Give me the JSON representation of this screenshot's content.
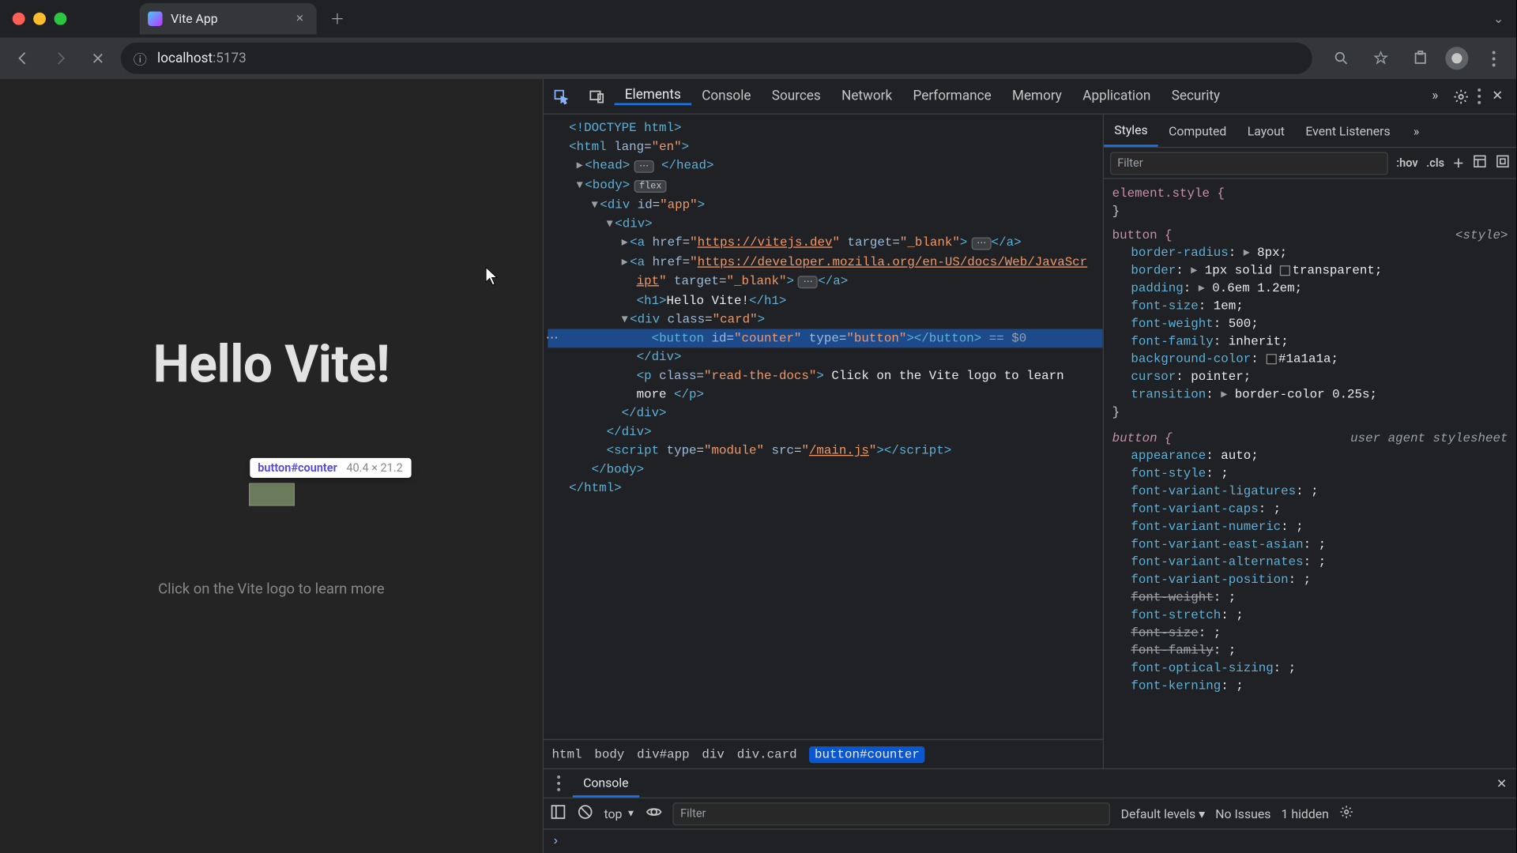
{
  "chrome": {
    "tab_title": "Vite App",
    "url_host": "localhost",
    "url_port": ":5173"
  },
  "page": {
    "heading": "Hello Vite!",
    "docs": "Click on the Vite logo to learn more",
    "inspect_tooltip_selector": "button#counter",
    "inspect_tooltip_dims": "40.4 × 21.2"
  },
  "devtools": {
    "tabs": [
      "Elements",
      "Console",
      "Sources",
      "Network",
      "Performance",
      "Memory",
      "Application",
      "Security"
    ],
    "styles_tabs": [
      "Styles",
      "Computed",
      "Layout",
      "Event Listeners"
    ],
    "breadcrumbs": [
      "html",
      "body",
      "div#app",
      "div",
      "div.card",
      "button#counter"
    ],
    "styles_filter_placeholder": "Filter",
    "styles_hov": ":hov",
    "styles_cls": ".cls",
    "element_style": "element.style {",
    "style_source": "<style>",
    "ua_source": "user agent stylesheet",
    "console_scope": "top",
    "console_levels": "Default levels ▾",
    "console_issues": "No Issues",
    "console_hidden": "1 hidden",
    "console_filter_placeholder": "Filter",
    "drawer_tab": "Console"
  },
  "dom": {
    "l1": "<!DOCTYPE html>",
    "l2": "<html lang=\"en\">",
    "l3_a": "<head>",
    "l3_b": "</head>",
    "l4": "<body>",
    "l4_badge": "flex",
    "l5": "<div id=\"app\">",
    "l6": "<div>",
    "l7_a_open": "<a href=\"",
    "l7_url": "https://vitejs.dev",
    "l7_a_mid": "\" target=\"",
    "l7_tgt": "_blank",
    "l7_a_end": "\">",
    "l7_close": "</a>",
    "l8_a_open": "<a href=\"",
    "l8_url": "https://developer.mozilla.org/en-US/docs/Web/JavaScr",
    "l8_url2": "ipt",
    "l8_mid": "\" target=\"",
    "l8_tgt": "_blank",
    "l8_end": "\">",
    "l8_close": "</a>",
    "l9": "<h1>Hello Vite!</h1>",
    "l10": "<div class=\"card\">",
    "l11": "<button id=\"counter\" type=\"button\"></button>",
    "l11_eq": " == $0",
    "l12": "</div>",
    "l13_a": "<p class=\"",
    "l13_cls": "read-the-docs",
    "l13_b": "\"> Click on the Vite logo to learn",
    "l14": "more </p>",
    "l15": "</div>",
    "l16": "</div>",
    "l17_a": "<script type=\"",
    "l17_t": "module",
    "l17_b": "\" src=\"",
    "l17_src": "/main.js",
    "l17_c": "\"></script>",
    "l18": "</body>",
    "l19": "</html>"
  },
  "rules": {
    "button_sel": "button {",
    "r1_p": "border-radius",
    "r1_v": "8px",
    "r2_p": "border",
    "r2_v": "1px solid",
    "r2_v2": "transparent",
    "r3_p": "padding",
    "r3_v": "0.6em 1.2em",
    "r4_p": "font-size",
    "r4_v": "1em",
    "r5_p": "font-weight",
    "r5_v": "500",
    "r6_p": "font-family",
    "r6_v": "inherit",
    "r7_p": "background-color",
    "r7_v": "#1a1a1a",
    "r8_p": "cursor",
    "r8_v": "pointer",
    "r9_p": "transition",
    "r9_v": "border-color 0.25s",
    "u1_p": "appearance",
    "u1_v": "auto",
    "u2_p": "font-style",
    "u2_v": "",
    "u3_p": "font-variant-ligatures",
    "u3_v": "",
    "u4_p": "font-variant-caps",
    "u4_v": "",
    "u5_p": "font-variant-numeric",
    "u5_v": "",
    "u6_p": "font-variant-east-asian",
    "u6_v": "",
    "u7_p": "font-variant-alternates",
    "u7_v": "",
    "u8_p": "font-variant-position",
    "u8_v": "",
    "u9_p": "font-weight",
    "u9_v": "",
    "u10_p": "font-stretch",
    "u10_v": "",
    "u11_p": "font-size",
    "u11_v": "",
    "u12_p": "font-family",
    "u12_v": "",
    "u13_p": "font-optical-sizing",
    "u13_v": "",
    "u14_p": "font-kerning",
    "u14_v": ""
  }
}
